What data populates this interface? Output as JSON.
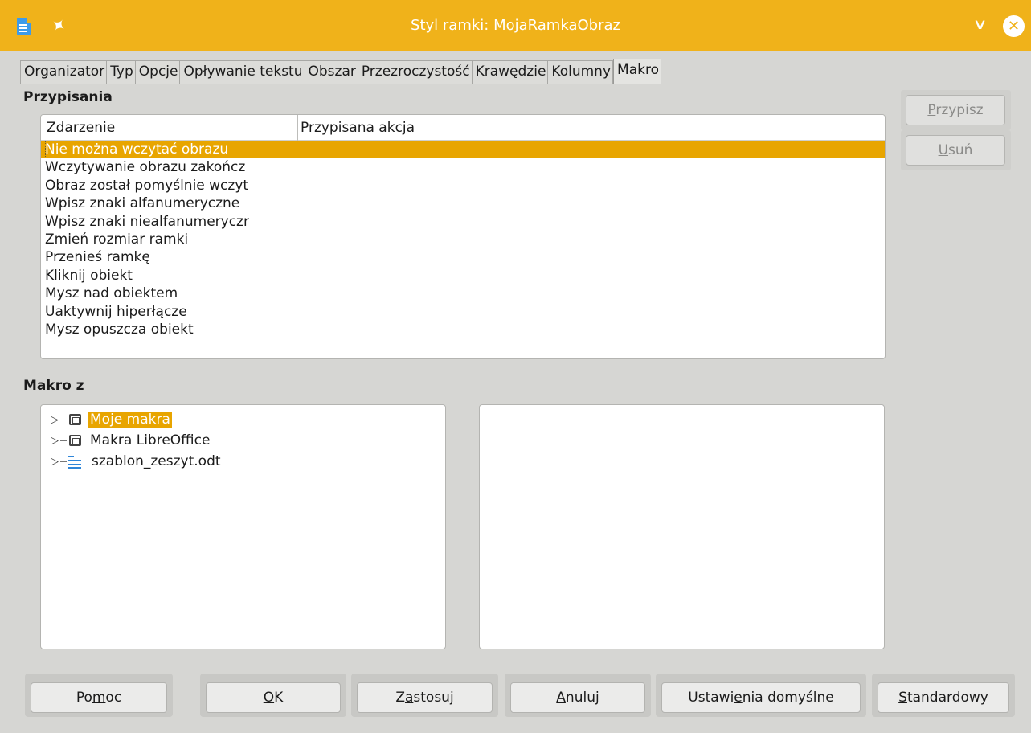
{
  "window": {
    "title": "Styl ramki: MojaRamkaObraz"
  },
  "tabs": [
    {
      "label": "Organizator"
    },
    {
      "label": "Typ"
    },
    {
      "label": "Opcje"
    },
    {
      "label": "Opływanie tekstu"
    },
    {
      "label": "Obszar"
    },
    {
      "label": "Przezroczystość"
    },
    {
      "label": "Krawędzie"
    },
    {
      "label": "Kolumny"
    },
    {
      "label": "Makro",
      "active": true
    }
  ],
  "assignments": {
    "section_label": "Przypisania",
    "columns": [
      "Zdarzenie",
      "Przypisana akcja"
    ],
    "events": [
      "Nie można wczytać obrazu",
      "Wczytywanie obrazu zakończ",
      "Obraz został pomyślnie wczyt",
      "Wpisz znaki alfanumeryczne",
      "Wpisz znaki niealfanumeryczr",
      "Zmień rozmiar ramki",
      "Przenieś ramkę",
      "Kliknij obiekt",
      "Mysz nad obiektem",
      "Uaktywnij hiperłącze",
      "Mysz opuszcza obiekt"
    ],
    "selected_index": 0,
    "assign_button": {
      "before": "",
      "mnemonic": "P",
      "after": "rzypisz"
    },
    "remove_button": {
      "before": "",
      "mnemonic": "U",
      "after": "suń"
    }
  },
  "macro_from": {
    "section_label": "Makro z",
    "tree": [
      {
        "label": "Moje makra",
        "icon": "monitor-icon",
        "selected": true
      },
      {
        "label": "Makra LibreOffice",
        "icon": "monitor-icon"
      },
      {
        "label": "szablon_zeszyt.odt",
        "icon": "writer-document-icon"
      }
    ]
  },
  "buttons": {
    "help": {
      "before": "Po",
      "mnemonic": "m",
      "after": "oc"
    },
    "ok": {
      "before": "",
      "mnemonic": "O",
      "after": "K"
    },
    "apply": {
      "before": "Z",
      "mnemonic": "a",
      "after": "stosuj"
    },
    "cancel": {
      "before": "",
      "mnemonic": "A",
      "after": "nuluj"
    },
    "defaults": {
      "before": "Ustawi",
      "mnemonic": "e",
      "after": "nia domyślne"
    },
    "standard": {
      "before": "",
      "mnemonic": "S",
      "after": "tandardowy"
    }
  },
  "colors": {
    "titlebar": "#f0b21a",
    "selection": "#e8a500"
  }
}
